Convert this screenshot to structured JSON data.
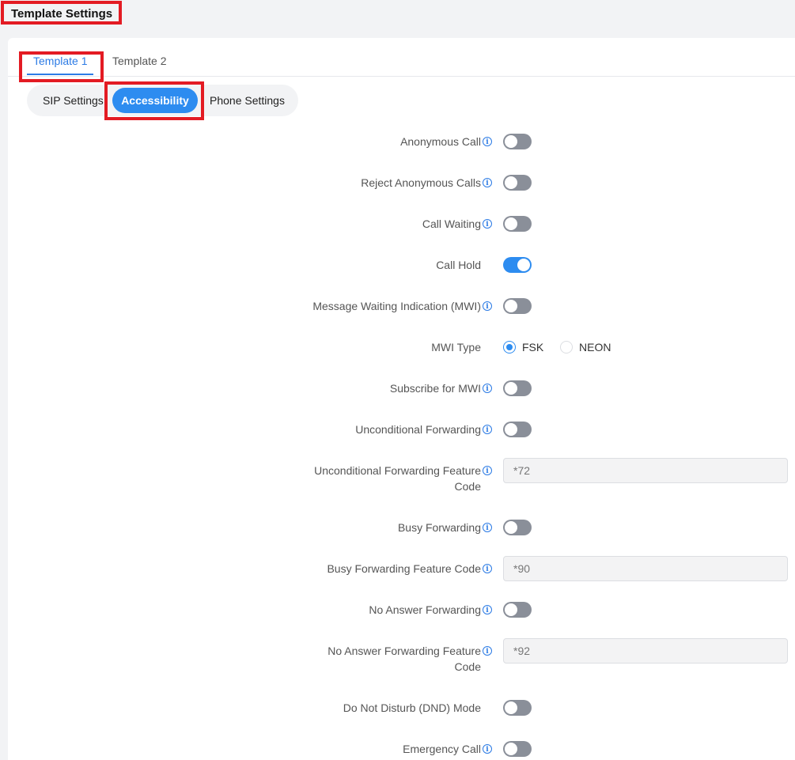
{
  "page": {
    "title": "Template Settings"
  },
  "tabs": [
    {
      "label": "Template 1",
      "active": true
    },
    {
      "label": "Template 2",
      "active": false
    }
  ],
  "subtabs": [
    {
      "label": "SIP Settings",
      "active": false
    },
    {
      "label": "Accessibility",
      "active": true
    },
    {
      "label": "Phone Settings",
      "active": false
    }
  ],
  "settings": {
    "anonymous_call": {
      "label": "Anonymous Call",
      "on": false
    },
    "reject_anonymous_calls": {
      "label": "Reject Anonymous Calls",
      "on": false
    },
    "call_waiting": {
      "label": "Call Waiting",
      "on": false
    },
    "call_hold": {
      "label": "Call Hold",
      "on": true
    },
    "mwi": {
      "label": "Message Waiting Indication (MWI)",
      "on": false
    },
    "mwi_type": {
      "label": "MWI Type",
      "options": [
        "FSK",
        "NEON"
      ],
      "selected": "FSK"
    },
    "subscribe_mwi": {
      "label": "Subscribe for MWI",
      "on": false
    },
    "unconditional_forwarding": {
      "label": "Unconditional Forwarding",
      "on": false
    },
    "unconditional_forwarding_code": {
      "label_line1": "Unconditional Forwarding Feature",
      "label_line2": "Code",
      "value": "*72"
    },
    "busy_forwarding": {
      "label": "Busy Forwarding",
      "on": false
    },
    "busy_forwarding_code": {
      "label": "Busy Forwarding Feature Code",
      "value": "*90"
    },
    "no_answer_forwarding": {
      "label": "No Answer Forwarding",
      "on": false
    },
    "no_answer_forwarding_code": {
      "label_line1": "No Answer Forwarding Feature",
      "label_line2": "Code",
      "value": "*92"
    },
    "dnd_mode": {
      "label": "Do Not Disturb (DND) Mode",
      "on": false
    },
    "emergency_call": {
      "label": "Emergency Call",
      "on": false
    }
  },
  "icons": {
    "info": "info-icon"
  },
  "colors": {
    "accent": "#2d8cf0",
    "toggle_off": "#8a8f99",
    "highlight": "#e31b23"
  }
}
